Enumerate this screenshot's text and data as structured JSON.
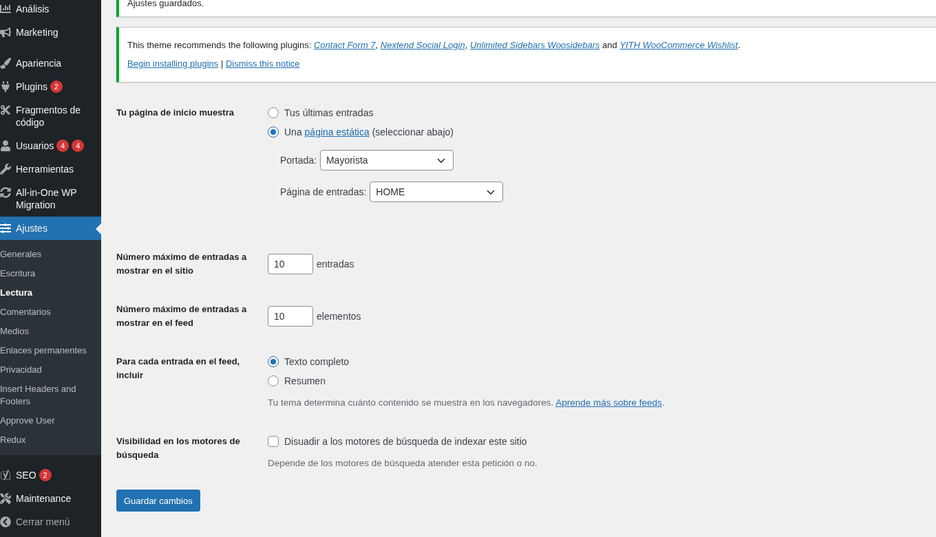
{
  "sidebar": {
    "menu_top": [
      {
        "label": "Análisis",
        "current": false
      },
      {
        "label": "Marketing",
        "current": false
      }
    ],
    "menu_main": [
      {
        "label": "Apariencia",
        "current": false
      },
      {
        "label": "Plugins",
        "badges": [
          "2"
        ],
        "current": false
      },
      {
        "label": "Fragmentos de código",
        "current": false
      },
      {
        "label": "Usuarios",
        "badges": [
          "4",
          "4"
        ],
        "current": false
      },
      {
        "label": "Herramientas",
        "current": false
      },
      {
        "label": "All-in-One WP Migration",
        "current": false
      },
      {
        "label": "Ajustes",
        "current": true
      }
    ],
    "submenu": [
      {
        "label": "Generales",
        "selected": false
      },
      {
        "label": "Escritura",
        "selected": false
      },
      {
        "label": "Lectura",
        "selected": true
      },
      {
        "label": "Comentarios",
        "selected": false
      },
      {
        "label": "Medios",
        "selected": false
      },
      {
        "label": "Enlaces permanentes",
        "selected": false
      },
      {
        "label": "Privacidad",
        "selected": false
      },
      {
        "label": "Insert Headers and Footers",
        "selected": false
      },
      {
        "label": "Approve User",
        "selected": false
      },
      {
        "label": "Redux",
        "selected": false
      }
    ],
    "menu_bottom": [
      {
        "label": "SEO",
        "badges": [
          "2"
        ]
      },
      {
        "label": "Maintenance"
      }
    ],
    "collapse": {
      "label": "Cerrar menú"
    }
  },
  "notices": [
    {
      "kind": "success",
      "text": "Ajustes guardados."
    },
    {
      "kind": "plugins",
      "parts": [
        {
          "text": "This theme recommends the following plugins: ",
          "link": false
        },
        {
          "text": "Contact Form 7",
          "link": true
        },
        {
          "text": ", ",
          "link": false
        },
        {
          "text": "Nextend Social Login",
          "link": true
        },
        {
          "text": ", ",
          "link": false
        },
        {
          "text": "Unlimited Sidebars Woosidebars",
          "link": true
        },
        {
          "text": " and ",
          "link": false
        },
        {
          "text": "YITH WooCommerce Wishlist",
          "link": true
        },
        {
          "text": ".",
          "link": false
        }
      ],
      "actions": [
        "Begin installing plugins",
        "Dismiss this notice"
      ],
      "separator": "|"
    }
  ],
  "settings": [
    {
      "kind": "front_page",
      "label": "Tu página de inicio muestra",
      "options": [
        {
          "parts": [
            {
              "text": "Tus últimas entradas",
              "link": false
            }
          ],
          "selected": false
        },
        {
          "parts": [
            {
              "text": "Una ",
              "link": false
            },
            {
              "text": "página estática",
              "link": true
            },
            {
              "text": " (seleccionar abajo)",
              "link": false
            }
          ],
          "selected": true
        }
      ],
      "selects": [
        {
          "label": "Portada:",
          "value": "Mayorista"
        },
        {
          "label": "Página de entradas:",
          "value": "HOME"
        }
      ]
    },
    {
      "kind": "number",
      "label": "Número máximo de entradas a mostrar en el sitio",
      "value": "10",
      "suffix": "entradas"
    },
    {
      "kind": "number",
      "label": "Número máximo de entradas a mostrar en el feed",
      "value": "10",
      "suffix": "elementos"
    },
    {
      "kind": "radios",
      "label": "Para cada entrada en el feed, incluir",
      "options": [
        {
          "parts": [
            {
              "text": "Texto completo",
              "link": false
            }
          ],
          "selected": true
        },
        {
          "parts": [
            {
              "text": "Resumen",
              "link": false
            }
          ],
          "selected": false
        }
      ],
      "description": [
        {
          "text": "Tu tema determina cuánto contenido se muestra en los navegadores. ",
          "link": false
        },
        {
          "text": "Aprende más sobre feeds",
          "link": true
        },
        {
          "text": ".",
          "link": false
        }
      ]
    },
    {
      "kind": "checkbox",
      "label": "Visibilidad en los motores de búsqueda",
      "option": "Disuadir a los motores de búsqueda de indexar este sitio",
      "checked": false,
      "description": [
        {
          "text": "Depende de los motores de búsqueda atender esta petición o no.",
          "link": false
        }
      ]
    }
  ],
  "save_button": "Guardar cambios"
}
